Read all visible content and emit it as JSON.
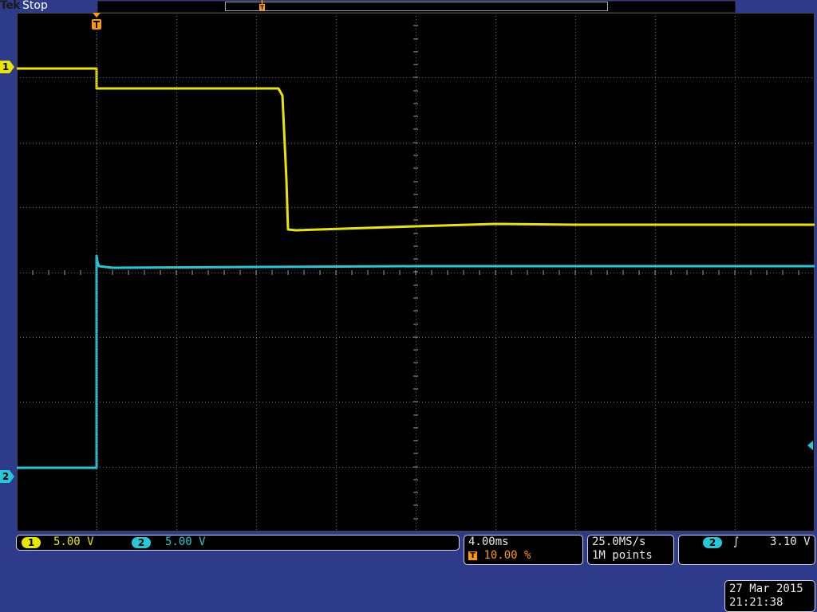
{
  "header": {
    "brand": "Tek",
    "acquisition_state": "Stop"
  },
  "channels": [
    {
      "id": "1",
      "scale": "5.00 V",
      "color": "#e6e600"
    },
    {
      "id": "2",
      "scale": "5.00 V",
      "color": "#25c8d6"
    }
  ],
  "trigger_marker": {
    "label": "T",
    "color": "#ff9a00"
  },
  "timebase": {
    "horizontal_scale": "4.00ms",
    "trigger_position_icon": "T",
    "trigger_position": "10.00 %"
  },
  "acquisition": {
    "sample_rate": "25.0MS/s",
    "record_length": "1M points"
  },
  "trigger": {
    "source": "2",
    "slope_icon": "rising-edge-icon",
    "slope_glyph": "∫",
    "level": "3.10 V"
  },
  "datetime": {
    "date": "27 Mar 2015",
    "time": "21:21:38"
  },
  "colors": {
    "background": "#2e3b8a",
    "screen": "#000000",
    "ch1": "#e6e600",
    "ch2": "#25c8d6",
    "trigger": "#ff9a00",
    "graticule": "#6a6a6a"
  }
}
